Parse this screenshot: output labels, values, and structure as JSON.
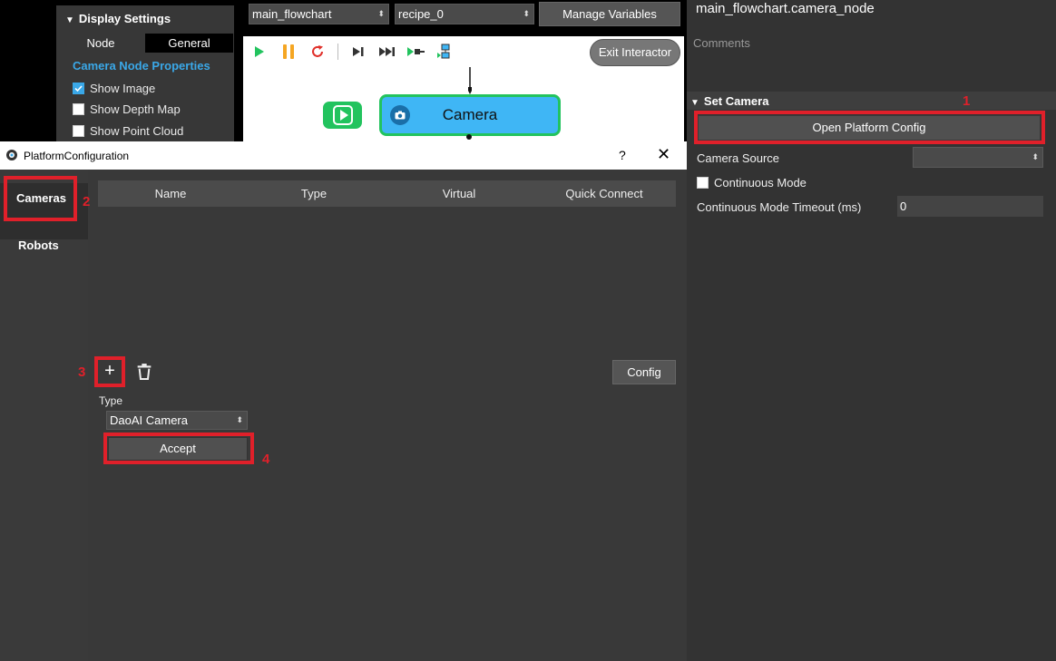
{
  "display_settings": {
    "title": "Display Settings",
    "tabs": [
      "Node",
      "General"
    ],
    "section_title": "Camera Node Properties",
    "options": [
      {
        "label": "Show Image",
        "checked": true
      },
      {
        "label": "Show Depth Map",
        "checked": false
      },
      {
        "label": "Show Point Cloud",
        "checked": false
      }
    ]
  },
  "top_bar": {
    "flowchart_select": "main_flowchart",
    "recipe_select": "recipe_0",
    "manage_variables_label": "Manage Variables"
  },
  "canvas": {
    "exit_interactor_label": "Exit Interactor",
    "camera_node_label": "Camera"
  },
  "right_panel": {
    "node_title": "main_flowchart.camera_node",
    "comments_label": "Comments",
    "set_camera_title": "Set Camera",
    "open_platform_config_label": "Open Platform Config",
    "camera_source_label": "Camera Source",
    "camera_source_value": "",
    "continuous_mode_label": "Continuous Mode",
    "timeout_label": "Continuous Mode Timeout (ms)",
    "timeout_value": "0"
  },
  "dialog": {
    "title": "PlatformConfiguration",
    "help": "?",
    "close": "✕",
    "sidebar": [
      "Cameras",
      "Robots"
    ],
    "table_columns": [
      "Name",
      "Type",
      "Virtual",
      "Quick Connect"
    ],
    "add_symbol": "+",
    "config_label": "Config",
    "type_label": "Type",
    "type_value": "DaoAI Camera",
    "accept_label": "Accept"
  },
  "annotations": [
    "1",
    "2",
    "3",
    "4"
  ],
  "colors": {
    "accent_blue": "#3aa8e8",
    "highlight_red": "#e0202a",
    "node_green": "#22c35e",
    "node_blue": "#3fb6f5"
  }
}
